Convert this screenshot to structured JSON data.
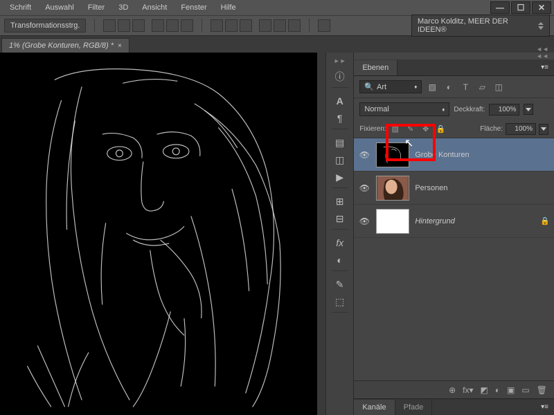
{
  "menu": [
    "Schrift",
    "Auswahl",
    "Filter",
    "3D",
    "Ansicht",
    "Fenster",
    "Hilfe"
  ],
  "optionsBar": {
    "transform": "Transformationsstrg.",
    "preset": "Marco Kolditz, MEER DER IDEEN®"
  },
  "docTab": "1% (Grobe Konturen, RGB/8) *",
  "panels": {
    "layers": "Ebenen",
    "kanale": "Kanäle",
    "pfade": "Pfade",
    "kindSearch": "Art",
    "blendMode": "Normal",
    "opacityLabel": "Deckkraft:",
    "opacityValue": "100%",
    "fillLabel": "Fläche:",
    "fillValue": "100%",
    "lockLabel": "Fixieren:"
  },
  "layers": {
    "l1": "Grobe Konturen",
    "l2": "Personen",
    "l3": "Hintergrund"
  },
  "footerIcons": [
    "⊕",
    "fx▾",
    "◩",
    "◐",
    "▭",
    "🗑"
  ],
  "windowControls": {
    "min": "—",
    "max": "☐",
    "close": "✕"
  }
}
